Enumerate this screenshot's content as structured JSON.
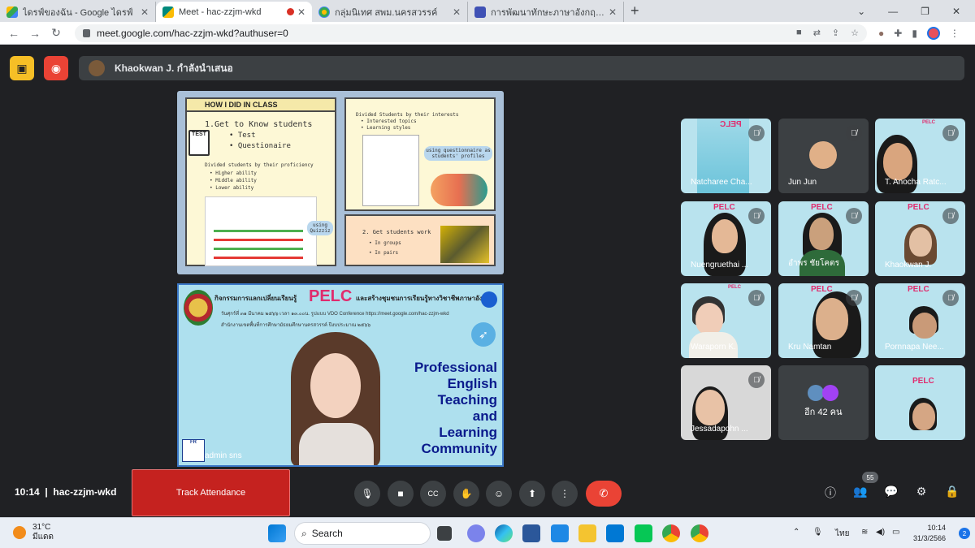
{
  "browser": {
    "tabs": [
      {
        "title": "ไดรฟ์ของฉัน - Google ไดรฟ์",
        "favicon_color": "#34a853"
      },
      {
        "title": "Meet - hac-zzjm-wkd",
        "favicon_color": "#00897b"
      },
      {
        "title": "กลุ่มนิเทศ สพม.นครสวรรค์",
        "favicon_color": "#fbbc04"
      },
      {
        "title": "การพัฒนาทักษะภาษาอังกฤษ English",
        "favicon_color": "#3f51b5"
      }
    ],
    "url": "meet.google.com/hac-zzjm-wkd?authuser=0"
  },
  "meet": {
    "presenting_text": "Khaokwan J. กำลังนำเสนอ",
    "slide1": {
      "header": "HOW I DID IN CLASS",
      "item1": "1.Get to Know students",
      "bullets1": [
        "Test",
        "Questionaire"
      ],
      "test_label": "TEST",
      "proficiency_title": "Divided students by their proficiency",
      "proficiency_levels": [
        "Higher ability",
        "Middle ability",
        "Lower ability"
      ],
      "using_quizziz": "using Quizziz",
      "interest_title": "Divided Students by their interests",
      "interest_items": [
        "Interested topics",
        "Learning styles"
      ],
      "questionnaire_note": "using questionnaire as students' profiles",
      "item2": "2. Get students work",
      "bullets2": [
        "In groups",
        "In pairs"
      ]
    },
    "slide2": {
      "title_th": "กิจกรรมการแลกเปลี่ยนเรียนรู้",
      "pelc": "PELC",
      "title_th2": "และสร้างชุมชนการเรียนรู้ทางวิชาชีพภาษาอังกฤษ",
      "date_line": "วันศุกร์ที่ ๓๑ มีนาคม ๒๕๖๖ เวลา ๑๓.๐๐น. รูปแบบ VDO Conference https://meet.google.com/hac-zzjm-wkd",
      "office_line": "สำนักงานเขตพื้นที่การศึกษามัธยมศึกษานครสวรรค์ ปีงบประมาณ ๒๕๖๖",
      "right_text": [
        "Professional",
        "English",
        "Teaching",
        "and",
        "Learning",
        "Community"
      ],
      "name_tag": "admin sns",
      "logo_text": "FR"
    },
    "participants": [
      {
        "name": "Natcharee Cha...",
        "muted": true
      },
      {
        "name": "Jun Jun",
        "muted": true
      },
      {
        "name": "T. Anocha Ratc...",
        "muted": true
      },
      {
        "name": "Nuengruethai ...",
        "muted": true
      },
      {
        "name": "อำพร ชัยโคตร",
        "muted": true
      },
      {
        "name": "Khaokwan J.",
        "muted": true
      },
      {
        "name": "Waraporn K.",
        "muted": true
      },
      {
        "name": "Kru Namtan",
        "muted": true
      },
      {
        "name": "Pornnapa Nee...",
        "muted": true
      },
      {
        "name": "Jessadapohn ...",
        "muted": true
      },
      {
        "name": "อีก 42 คน",
        "muted": false
      },
      {
        "name": "",
        "muted": false
      }
    ],
    "tile_slide_label": "PELC",
    "time": "10:14",
    "meeting_code": "hac-zzjm-wkd",
    "track_attendance": "Track Attendance",
    "participant_count": "55"
  },
  "taskbar": {
    "temperature": "31°C",
    "weather": "มีแดด",
    "search_label": "Search",
    "language": "ไทย",
    "time": "10:14",
    "date": "31/3/2566",
    "notifications": "2"
  }
}
